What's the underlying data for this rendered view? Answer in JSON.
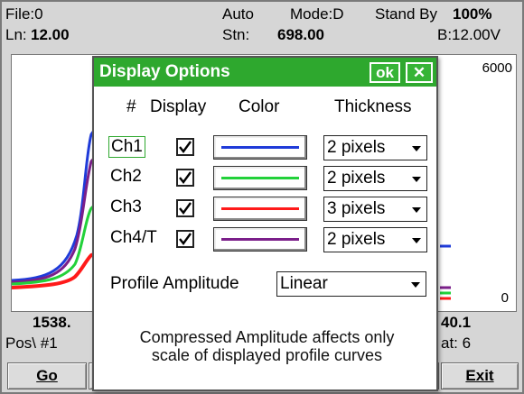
{
  "header": {
    "file_label": "File:0",
    "mode_auto": "Auto",
    "mode": "Mode:D",
    "standby": "Stand By",
    "battery": "100%",
    "ln_label": "Ln:",
    "ln_value": "12.00",
    "stn_label": "Stn:",
    "stn_value": "698.00",
    "voltage": "B:12.00V"
  },
  "plot": {
    "top_value": "6000",
    "bottom_value": "0",
    "trace_colors": [
      "#1f3bd9",
      "#7b1f8a",
      "#22d13a",
      "#ff1a1a"
    ]
  },
  "info": {
    "left_big": "1538.",
    "left_small": "Pos\\ #1",
    "right_big": "40.1",
    "right_small": "at: 6"
  },
  "buttons": {
    "go": "Go",
    "exit": "Exit"
  },
  "dialog": {
    "title": "Display Options",
    "ok": "ok",
    "close": "✕",
    "columns": {
      "num": "#",
      "display": "Display",
      "color": "Color",
      "thickness": "Thickness"
    },
    "channels": [
      {
        "label": "Ch1",
        "checked": true,
        "color": "#1f3bd9",
        "thickness": "2 pixels"
      },
      {
        "label": "Ch2",
        "checked": true,
        "color": "#22d13a",
        "thickness": "2 pixels"
      },
      {
        "label": "Ch3",
        "checked": true,
        "color": "#ff1a1a",
        "thickness": "3 pixels"
      },
      {
        "label": "Ch4/T",
        "checked": true,
        "color": "#7b1f8a",
        "thickness": "2 pixels"
      }
    ],
    "amplitude_label": "Profile Amplitude",
    "amplitude_value": "Linear",
    "note_line1": "Compressed Amplitude affects only",
    "note_line2": "scale of displayed profile curves"
  },
  "colors": {
    "title_bar": "#2ea82e",
    "background": "#d6d6d6"
  }
}
